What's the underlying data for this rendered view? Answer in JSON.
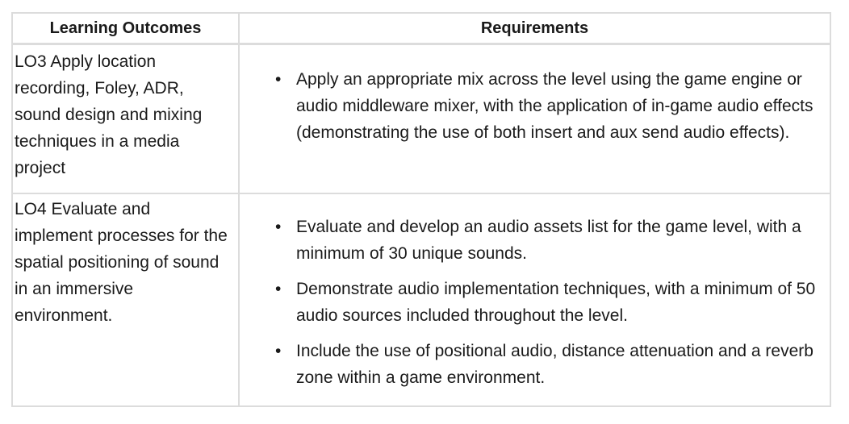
{
  "table": {
    "headers": {
      "learning_outcomes": "Learning Outcomes",
      "requirements": "Requirements"
    },
    "rows": [
      {
        "outcome": "LO3 Apply location recording, Foley, ADR, sound design and mixing techniques in a media project",
        "requirements": [
          "Apply an appropriate mix across the level using the game engine or audio middleware mixer, with the application of in-game audio effects (demonstrating the use of both insert and aux send audio effects)."
        ]
      },
      {
        "outcome": "LO4 Evaluate and implement processes for the spatial positioning of sound in an immersive environment.",
        "requirements": [
          "Evaluate and develop an audio assets list for the game level, with a minimum of 30 unique sounds.",
          "Demonstrate audio implementation techniques, with a minimum of 50 audio sources included throughout the level.",
          "Include the use of positional audio, distance attenuation and a reverb zone within a game environment."
        ]
      }
    ],
    "bullet_glyph": "•"
  }
}
